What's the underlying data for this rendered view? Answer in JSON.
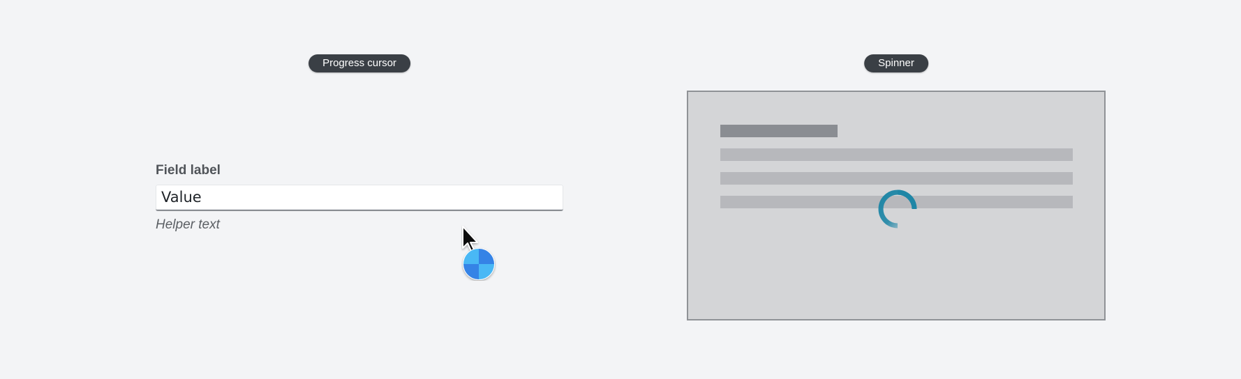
{
  "labels": {
    "left": "Progress cursor",
    "right": "Spinner"
  },
  "field": {
    "label": "Field label",
    "value": "Value",
    "helper": "Helper text"
  },
  "cursor": {
    "icon": "progress-cursor-icon",
    "colors": [
      "#4ab8f5",
      "#3583e6"
    ]
  },
  "spinner": {
    "icon": "spinner-icon",
    "color": "#1f86a6"
  }
}
